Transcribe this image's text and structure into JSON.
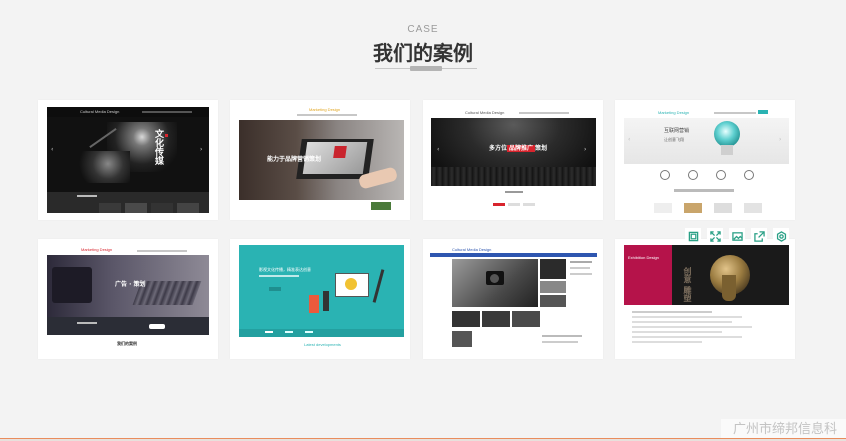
{
  "section": {
    "subtitle": "CASE",
    "title": "我们的案例"
  },
  "cases": [
    {
      "logo": "Cultural Media Design",
      "banner": "文化传媒"
    },
    {
      "logo": "Marketing Design",
      "banner": "能力于品牌营销策划"
    },
    {
      "logo": "Cultural Media Design",
      "banner_pre": "多方位",
      "banner_hl": "品牌推广",
      "banner_post": "策划"
    },
    {
      "logo": "Marketing Design",
      "banner_l1": "互联网营销",
      "banner_l2": "让创意飞翔"
    },
    {
      "logo": "Marketing Design",
      "banner": "广告 · 策划",
      "caption": "我们的案例"
    },
    {
      "banner": "影视文化传播，精准表达创意",
      "caption": "Latest developments"
    },
    {
      "logo": "Cultural Media Design"
    },
    {
      "logo": "Exhibition Design",
      "banner": "创意 雕塑"
    }
  ],
  "hover_icons": [
    "frame-icon",
    "expand-icon",
    "image-icon",
    "export-icon",
    "settings-icon"
  ],
  "watermark": "广州市缔邦信息科",
  "colors": {
    "accent_red": "#d8242d",
    "teal": "#2ab3b3",
    "icon_green": "#2aa086",
    "crimson": "#b5134a",
    "blue": "#2e56b0"
  }
}
